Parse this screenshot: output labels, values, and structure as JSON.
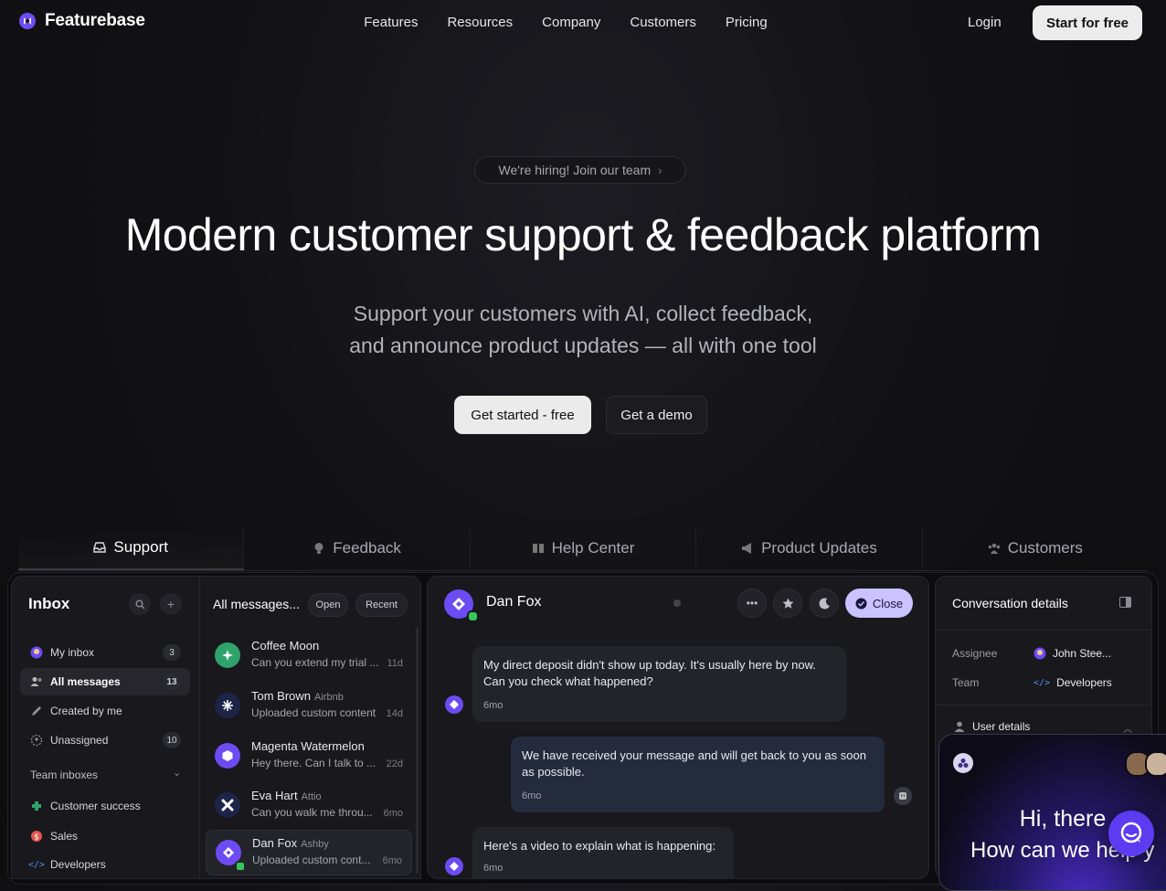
{
  "brand": {
    "name": "Featurebase",
    "accent": "#6d4bf2"
  },
  "nav": {
    "links": [
      "Features",
      "Resources",
      "Company",
      "Customers",
      "Pricing"
    ],
    "login": "Login",
    "start": "Start for free"
  },
  "hero": {
    "hiring": "We're hiring! Join our team",
    "title": "Modern customer support & feedback platform",
    "subtitle_line1": "Support your customers with AI, collect feedback,",
    "subtitle_line2": "and announce product updates — all with one tool",
    "cta_primary": "Get started - free",
    "cta_secondary": "Get a demo"
  },
  "tabs": [
    {
      "label": "Support",
      "icon": "inbox-icon"
    },
    {
      "label": "Feedback",
      "icon": "lightbulb-icon"
    },
    {
      "label": "Help Center",
      "icon": "book-icon"
    },
    {
      "label": "Product Updates",
      "icon": "megaphone-icon"
    },
    {
      "label": "Customers",
      "icon": "users-icon"
    }
  ],
  "inbox": {
    "title": "Inbox",
    "items": [
      {
        "label": "My inbox",
        "count": "3"
      },
      {
        "label": "All messages",
        "count": "13"
      },
      {
        "label": "Created by me",
        "count": ""
      },
      {
        "label": "Unassigned",
        "count": "10"
      }
    ],
    "team_section": "Team inboxes",
    "teams": [
      "Customer success",
      "Sales",
      "Developers"
    ]
  },
  "messages": {
    "header": "All messages...",
    "filter_open": "Open",
    "filter_recent": "Recent",
    "list": [
      {
        "name": "Coffee Moon",
        "company": "",
        "preview": "Can you extend my trial ...",
        "time": "11d",
        "color": "#2fa36b"
      },
      {
        "name": "Tom Brown",
        "company": "Airbnb",
        "preview": "Uploaded custom content",
        "time": "14d",
        "color": "#1d2448"
      },
      {
        "name": "Magenta Watermelon",
        "company": "",
        "preview": "Hey there. Can I talk to ...",
        "time": "22d",
        "color": "#6d4bf2"
      },
      {
        "name": "Eva Hart",
        "company": "Attio",
        "preview": "Can you walk me throu...",
        "time": "6mo",
        "color": "#1d2448"
      },
      {
        "name": "Dan Fox",
        "company": "Ashby",
        "preview": "Uploaded custom cont...",
        "time": "6mo",
        "color": "#6d4bf2"
      }
    ]
  },
  "chat": {
    "name": "Dan Fox",
    "close": "Close",
    "messages": [
      {
        "text": "My direct deposit didn't show up today. It's usually here by now. Can you check what happened?",
        "time": "6mo"
      },
      {
        "text": "We have received your message and will get back to you as soon as possible.",
        "time": "6mo"
      },
      {
        "text": "Here's a video to explain what is happening:",
        "time": "6mo"
      }
    ]
  },
  "details": {
    "title": "Conversation details",
    "assignee_label": "Assignee",
    "assignee_value": "John Stee...",
    "team_label": "Team",
    "team_value": "Developers",
    "user_details": "User details"
  },
  "widget": {
    "greeting": "Hi, there",
    "question": "How can we help y"
  }
}
